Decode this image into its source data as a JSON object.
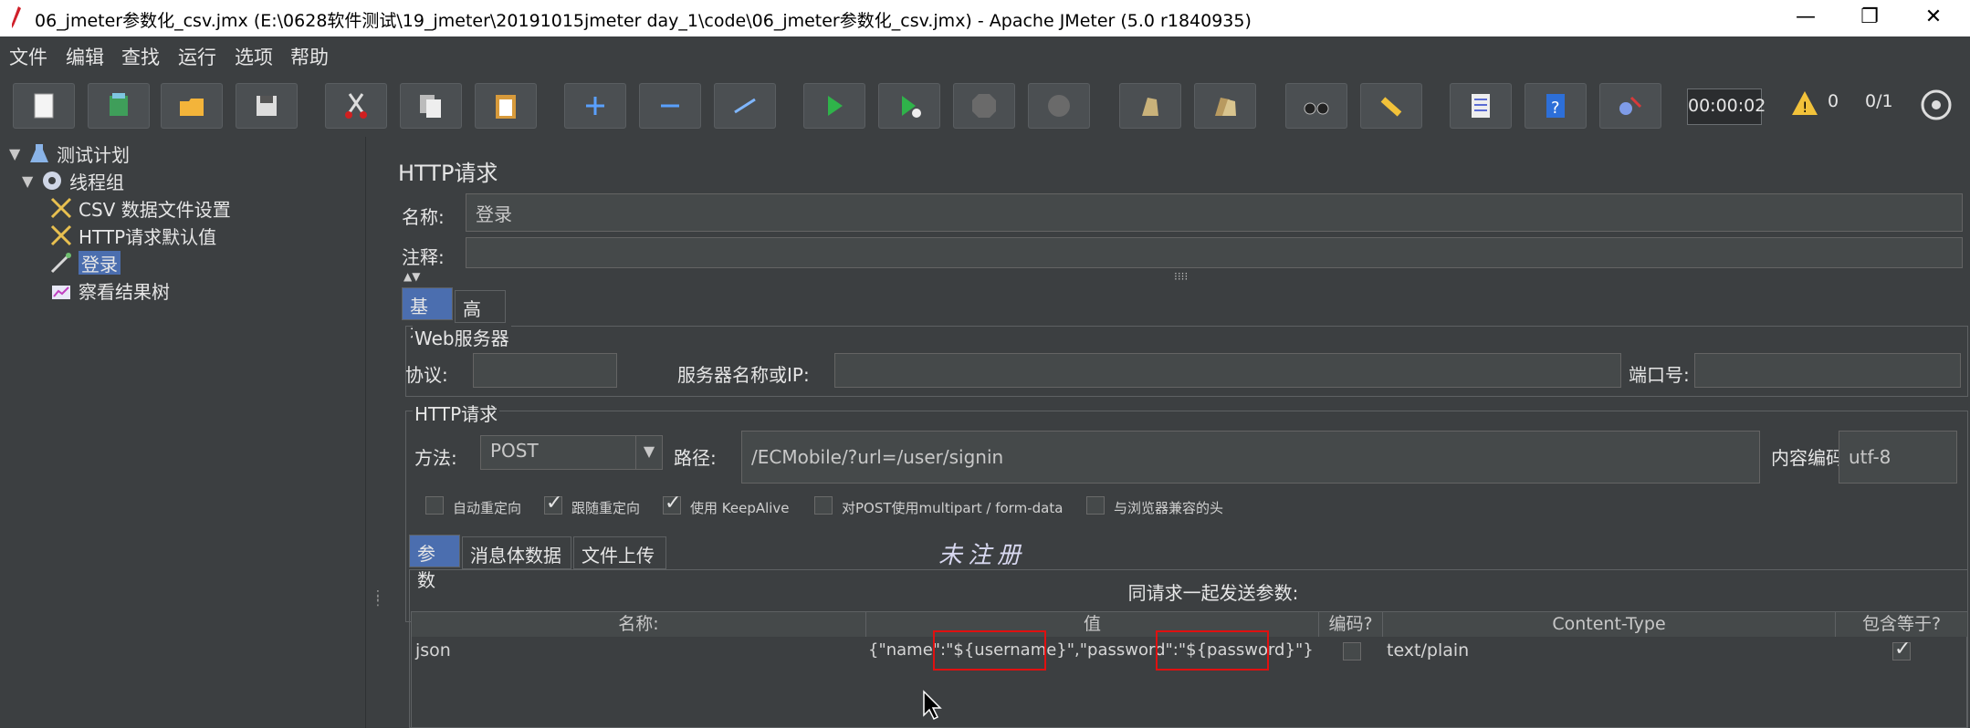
{
  "window": {
    "title": "06_jmeter参数化_csv.jmx (E:\\0628软件测试\\19_jmeter\\20191015jmeter day_1\\code\\06_jmeter参数化_csv.jmx) - Apache JMeter (5.0 r1840935)",
    "controls": [
      "—",
      "❐",
      "✕"
    ]
  },
  "menu": [
    "文件",
    "编辑",
    "查找",
    "运行",
    "选项",
    "帮助"
  ],
  "toolbar": {
    "timer": "00:00:02",
    "warnings": "0",
    "threads": "0/1",
    "icons": [
      "new-icon",
      "templates-icon",
      "open-icon",
      "save-icon",
      "cut-icon",
      "copy-icon",
      "paste-icon",
      "expand-icon",
      "collapse-icon",
      "toggle-icon",
      "start-icon",
      "start-no-pause-icon",
      "stop-icon",
      "shutdown-icon",
      "clear-icon",
      "clear-all-icon",
      "search-icon",
      "reset-search-icon",
      "function-helper-icon",
      "help-icon",
      "remote-icon"
    ]
  },
  "tree": {
    "items": [
      {
        "label": "测试计划",
        "icon": "test-plan-icon"
      },
      {
        "label": "线程组",
        "icon": "thread-group-icon"
      },
      {
        "label": "CSV 数据文件设置",
        "icon": "config-element-icon"
      },
      {
        "label": "HTTP请求默认值",
        "icon": "config-element-icon"
      },
      {
        "label": "登录",
        "icon": "sampler-icon"
      },
      {
        "label": "察看结果树",
        "icon": "listener-icon"
      }
    ]
  },
  "panel": {
    "title": "HTTP请求",
    "name_label": "名称:",
    "name_value": "登录",
    "comment_label": "注释:",
    "tabs": [
      "基本",
      "高级"
    ],
    "web_server": {
      "legend": "Web服务器",
      "protocol_label": "协议:",
      "server_label": "服务器名称或IP:",
      "port_label": "端口号:"
    },
    "http_request": {
      "legend": "HTTP请求",
      "method_label": "方法:",
      "method_value": "POST",
      "path_label": "路径:",
      "path_value": "/ECMobile/?url=/user/signin",
      "encoding_label": "内容编码:",
      "encoding_value": "utf-8"
    },
    "checkboxes": [
      {
        "label": "自动重定向",
        "checked": false
      },
      {
        "label": "跟随重定向",
        "checked": true
      },
      {
        "label": "使用 KeepAlive",
        "checked": true
      },
      {
        "label": "对POST使用multipart / form-data",
        "checked": false
      },
      {
        "label": "与浏览器兼容的头",
        "checked": false
      }
    ],
    "sub_tabs": [
      "参数",
      "消息体数据",
      "文件上传"
    ],
    "watermark": "未注册",
    "params_heading": "同请求一起发送参数:",
    "table": {
      "headers": [
        "名称:",
        "值",
        "编码?",
        "Content-Type",
        "包含等于?"
      ],
      "rows": [
        {
          "name": "json",
          "value_parts": [
            "{\"name\":\"",
            "${username}",
            "\",\"password\":\"",
            "${password}",
            "\"}"
          ],
          "encode": false,
          "content_type": "text/plain",
          "include_equals": true
        }
      ]
    }
  }
}
